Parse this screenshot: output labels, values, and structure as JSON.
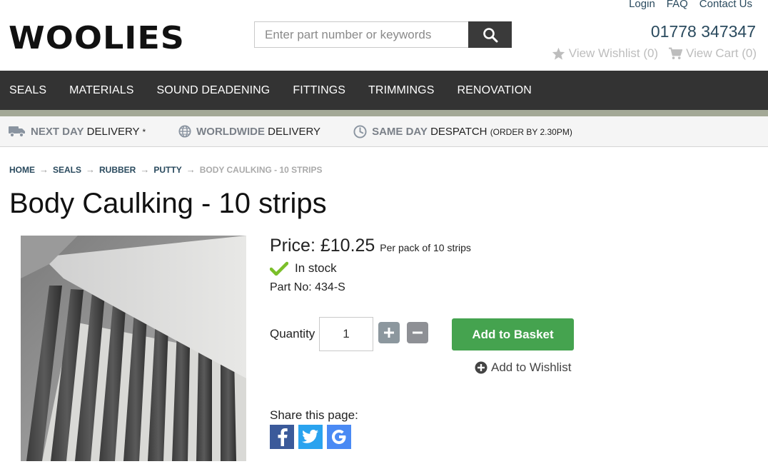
{
  "top_links": [
    "Login",
    "FAQ",
    "Contact Us"
  ],
  "logo": "WOOLIES",
  "search": {
    "placeholder": "Enter part number or keywords"
  },
  "phone": "01778 347347",
  "header_links": {
    "wishlist": "View Wishlist (0)",
    "cart": "View Cart (0)"
  },
  "nav": [
    "SEALS",
    "MATERIALS",
    "SOUND DEADENING",
    "FITTINGS",
    "TRIMMINGS",
    "RENOVATION"
  ],
  "usp": {
    "next_day": {
      "hi": "NEXT DAY",
      "rest": "DELIVERY",
      "mark": "*"
    },
    "worldwide": {
      "hi": "WORLDWIDE",
      "rest": "DELIVERY"
    },
    "same_day": {
      "hi": "SAME DAY",
      "rest": "DESPATCH",
      "small": "(ORDER BY 2.30PM)"
    }
  },
  "breadcrumb": [
    "HOME",
    "SEALS",
    "RUBBER",
    "PUTTY",
    "BODY CAULKING - 10 STRIPS"
  ],
  "product": {
    "title": "Body Caulking - 10 strips",
    "price_label": "Price:",
    "price": "£10.25",
    "price_note": "Per pack of 10 strips",
    "stock": "In stock",
    "part_no": "Part No: 434-S",
    "quantity_label": "Quantity",
    "quantity": "1",
    "add_to_basket": "Add to Basket",
    "add_to_wishlist": "Add to Wishlist"
  },
  "share": {
    "label": "Share this page:",
    "icons": [
      "facebook-icon",
      "twitter-icon",
      "google-icon"
    ]
  },
  "colors": {
    "nav_bg": "#333333",
    "accent_green": "#45a34f",
    "link_blue": "#2a4a5e",
    "stock_check": "#7bbf2a"
  }
}
